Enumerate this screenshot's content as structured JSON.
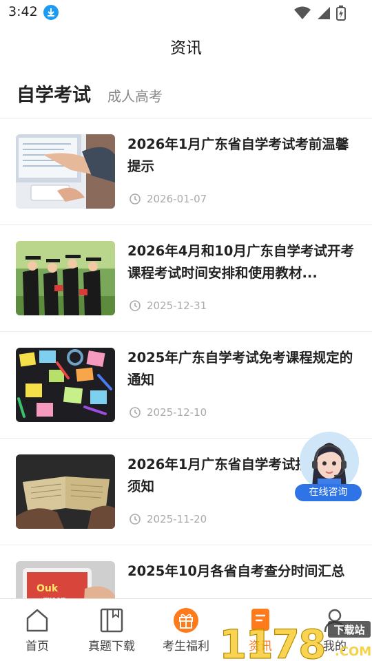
{
  "status": {
    "time": "3:42"
  },
  "header": {
    "title": "资讯"
  },
  "tabs": [
    {
      "label": "自学考试"
    },
    {
      "label": "成人高考"
    }
  ],
  "articles": [
    {
      "title": "2026年1月广东省自学考试考前温馨提示",
      "date": "2026-01-07",
      "thumb": "person-using-computer"
    },
    {
      "title": "2026年4月和10月广东自学考试开考课程考试时间安排和使用教材...",
      "date": "2025-12-31",
      "thumb": "graduates-photo"
    },
    {
      "title": "2025年广东自学考试免考课程规定的通知",
      "date": "2025-12-10",
      "thumb": "sticky-notes-markers"
    },
    {
      "title": "2026年1月广东省自学考试报名报考须知",
      "date": "2025-11-20",
      "thumb": "open-book-hands"
    },
    {
      "title": "2025年10月各省自考查分时间汇总",
      "date": "",
      "thumb": "tablet-hand"
    }
  ],
  "consult": {
    "label": "在线咨询"
  },
  "nav": [
    {
      "label": "首页",
      "icon": "home-icon"
    },
    {
      "label": "真题下载",
      "icon": "book-icon"
    },
    {
      "label": "考生福利",
      "icon": "gift-icon"
    },
    {
      "label": "资讯",
      "icon": "news-icon"
    },
    {
      "label": "我的",
      "icon": "user-icon"
    }
  ],
  "watermark": {
    "text": "1178",
    "sub": "下载站",
    "suffix": ".COM"
  },
  "colors": {
    "accent": "#ff7a1a",
    "consult": "#2e74e6",
    "download": "#1b9cf2"
  }
}
